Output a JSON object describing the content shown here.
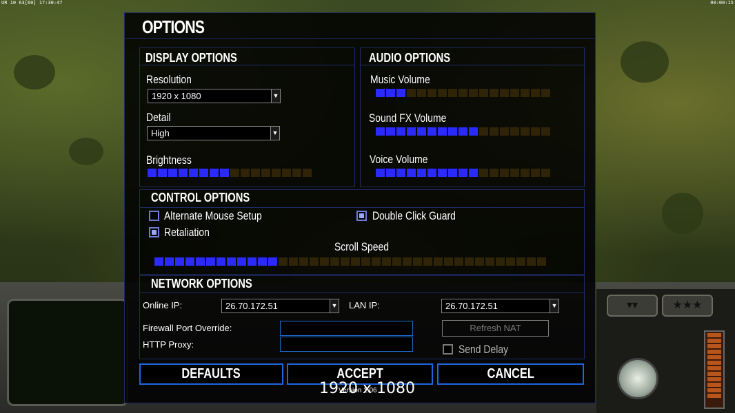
{
  "topbar": {
    "left": "UR 10 63[60] 17:30:47",
    "right": "00:00:15"
  },
  "dialog": {
    "title": "OPTIONS",
    "display": {
      "title": "DISPLAY OPTIONS",
      "resolution_label": "Resolution",
      "resolution_value": "1920 x 1080",
      "detail_label": "Detail",
      "detail_value": "High",
      "brightness_label": "Brightness",
      "brightness_level": 0.5
    },
    "audio": {
      "title": "AUDIO OPTIONS",
      "music_label": "Music Volume",
      "music_level": 0.15,
      "sfx_label": "Sound FX Volume",
      "sfx_level": 0.6,
      "voice_label": "Voice Volume",
      "voice_level": 0.6
    },
    "control": {
      "title": "CONTROL OPTIONS",
      "alt_mouse_label": "Alternate Mouse Setup",
      "alt_mouse_checked": false,
      "double_click_label": "Double Click Guard",
      "double_click_checked": true,
      "retaliation_label": "Retaliation",
      "retaliation_checked": true,
      "scroll_label": "Scroll Speed",
      "scroll_level": 0.32
    },
    "network": {
      "title": "NETWORK OPTIONS",
      "online_ip_label": "Online IP:",
      "online_ip_value": "26.70.172.51",
      "lan_ip_label": "LAN IP:",
      "lan_ip_value": "26.70.172.51",
      "firewall_label": "Firewall Port Override:",
      "firewall_value": "",
      "proxy_label": "HTTP Proxy:",
      "proxy_value": "",
      "refresh_nat_label": "Refresh NAT",
      "send_delay_label": "Send Delay",
      "send_delay_checked": false
    },
    "buttons": {
      "defaults": "DEFAULTS",
      "accept": "ACCEPT",
      "cancel": "CANCEL"
    },
    "version": "Version 1.06"
  },
  "overlay": {
    "resolution_text": "1920 x 1080"
  },
  "colors": {
    "accent": "#2a2aff",
    "slider_off": "#302408",
    "border": "#1e2a6a",
    "button_border": "#1f66e0"
  }
}
